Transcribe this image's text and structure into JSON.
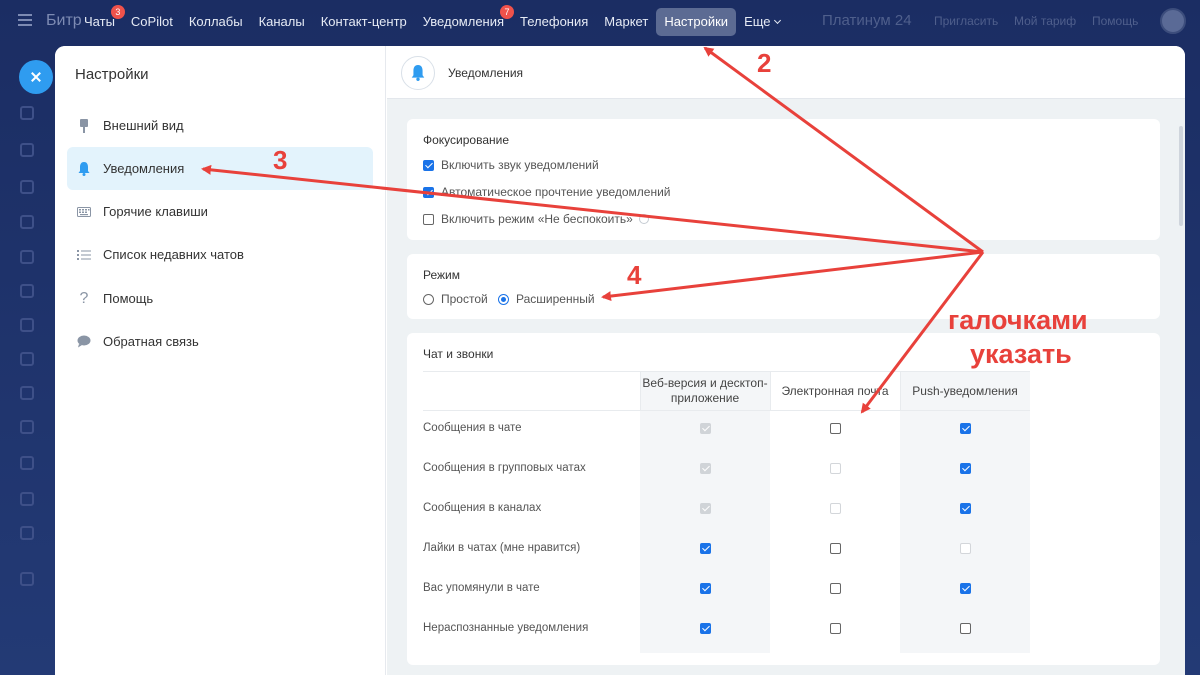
{
  "topbar": {
    "brand": "Битр",
    "nav": [
      {
        "label": "Чаты",
        "badge": "3"
      },
      {
        "label": "CoPilot"
      },
      {
        "label": "Коллабы"
      },
      {
        "label": "Каналы"
      },
      {
        "label": "Контакт-центр"
      },
      {
        "label": "Уведомления",
        "badge": "7"
      },
      {
        "label": "Телефония"
      },
      {
        "label": "Маркет"
      },
      {
        "label": "Настройки",
        "active": true
      },
      {
        "label": "Еще"
      }
    ],
    "right": [
      "Платинум 24",
      "Пригласить",
      "Мой тариф",
      "Помощь"
    ]
  },
  "sidebar": {
    "title": "Настройки",
    "items": [
      {
        "label": "Внешний вид",
        "icon": "brush-icon"
      },
      {
        "label": "Уведомления",
        "icon": "bell-icon",
        "active": true
      },
      {
        "label": "Горячие клавиши",
        "icon": "keyboard-icon"
      },
      {
        "label": "Список недавних чатов",
        "icon": "list-icon"
      },
      {
        "label": "Помощь",
        "icon": "question-icon"
      },
      {
        "label": "Обратная связь",
        "icon": "chat-bubble-icon"
      }
    ]
  },
  "main": {
    "title": "Уведомления",
    "focus": {
      "title": "Фокусирование",
      "options": [
        {
          "label": "Включить звук уведомлений",
          "checked": true
        },
        {
          "label": "Автоматическое прочтение уведомлений",
          "checked": true
        },
        {
          "label": "Включить режим «Не беспокоить»",
          "checked": false
        }
      ]
    },
    "mode": {
      "title": "Режим",
      "options": [
        {
          "label": "Простой",
          "checked": false
        },
        {
          "label": "Расширенный",
          "checked": true
        }
      ]
    },
    "chat": {
      "title": "Чат и звонки",
      "columns": [
        "Веб-версия и десктоп-приложение",
        "Электронная почта",
        "Push-уведомления"
      ],
      "rows": [
        {
          "label": "Сообщения в чате",
          "cells": [
            "checked-disabled",
            "unchecked",
            "checked"
          ]
        },
        {
          "label": "Сообщения в групповых чатах",
          "cells": [
            "checked-disabled",
            "disabled",
            "checked"
          ]
        },
        {
          "label": "Сообщения в каналах",
          "cells": [
            "checked-disabled",
            "disabled",
            "checked"
          ]
        },
        {
          "label": "Лайки в чатах (мне нравится)",
          "cells": [
            "checked",
            "unchecked",
            "disabled"
          ]
        },
        {
          "label": "Вас упомянули в чате",
          "cells": [
            "checked",
            "unchecked",
            "checked"
          ]
        },
        {
          "label": "Нераспознанные уведомления",
          "cells": [
            "checked",
            "unchecked",
            "unchecked"
          ]
        }
      ]
    }
  },
  "annotations": {
    "n2": "2",
    "n3": "3",
    "n4": "4",
    "note_line1": "галочками",
    "note_line2": "указать",
    "color": "#e8413b"
  }
}
